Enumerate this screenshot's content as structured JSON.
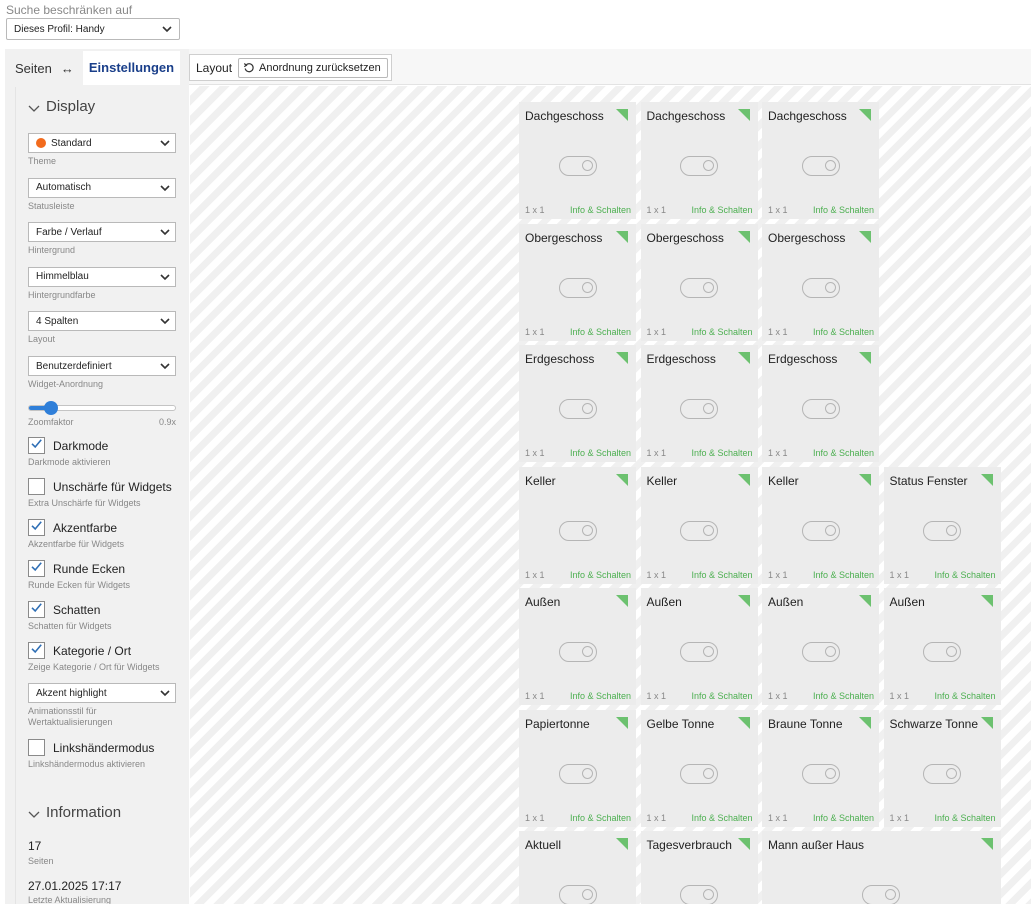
{
  "colors": {
    "accent": "#1a3f8a",
    "check": "#2f6fb5",
    "slider": "#2f7fd9",
    "tile_corner": "#6cc16f",
    "tile_type": "#4caf50",
    "theme_dot": "#f26b1d"
  },
  "scope": {
    "label": "Suche beschränken auf",
    "value": "Dieses Profil: Handy"
  },
  "sidebar": {
    "tab_pages": "Seiten",
    "swap_glyph": "↔",
    "tab_settings": "Einstellungen",
    "display": {
      "title": "Display",
      "fields": [
        {
          "value": "Standard",
          "caption": "Theme",
          "dot": true
        },
        {
          "value": "Automatisch",
          "caption": "Statusleiste"
        },
        {
          "value": "Farbe / Verlauf",
          "caption": "Hintergrund"
        },
        {
          "value": "Himmelblau",
          "caption": "Hintergrundfarbe"
        },
        {
          "value": "4 Spalten",
          "caption": "Layout"
        },
        {
          "value": "Benutzerdefiniert",
          "caption": "Widget-Anordnung"
        }
      ],
      "zoom": {
        "caption": "Zoomfaktor",
        "value_label": "0.9x",
        "fraction": 0.15
      },
      "checks": [
        {
          "label": "Darkmode",
          "caption": "Darkmode aktivieren",
          "checked": true
        },
        {
          "label": "Unschärfe für Widgets",
          "caption": "Extra Unschärfe für Widgets",
          "checked": false
        },
        {
          "label": "Akzentfarbe",
          "caption": "Akzentfarbe für Widgets",
          "checked": true
        },
        {
          "label": "Runde Ecken",
          "caption": "Runde Ecken für Widgets",
          "checked": true
        },
        {
          "label": "Schatten",
          "caption": "Schatten für Widgets",
          "checked": true
        },
        {
          "label": "Kategorie / Ort",
          "caption": "Zeige Kategorie / Ort für Widgets",
          "checked": true
        }
      ],
      "animation": {
        "value": "Akzent highlight",
        "caption_1": "Animationsstil für",
        "caption_2": "Wertaktualisierungen"
      },
      "lefthand": {
        "label": "Linkshändermodus",
        "caption": "Linkshändermodus aktivieren",
        "checked": false
      }
    },
    "information": {
      "title": "Information",
      "pages_value": "17",
      "pages_caption": "Seiten",
      "updated_value": "27.01.2025 17:17",
      "updated_caption": "Letzte Aktualisierung"
    }
  },
  "toolbar": {
    "layout_label": "Layout",
    "reset_label": "Anordnung zurücksetzen"
  },
  "tiles": [
    {
      "title": "Dachgeschoss",
      "size": "1 x 1",
      "type": "Info & Schalten"
    },
    {
      "title": "Dachgeschoss",
      "size": "1 x 1",
      "type": "Info & Schalten"
    },
    {
      "title": "Dachgeschoss",
      "size": "1 x 1",
      "type": "Info & Schalten"
    },
    {
      "title": "Obergeschoss",
      "size": "1 x 1",
      "type": "Info & Schalten"
    },
    {
      "title": "Obergeschoss",
      "size": "1 x 1",
      "type": "Info & Schalten"
    },
    {
      "title": "Obergeschoss",
      "size": "1 x 1",
      "type": "Info & Schalten"
    },
    {
      "title": "Erdgeschoss",
      "size": "1 x 1",
      "type": "Info & Schalten"
    },
    {
      "title": "Erdgeschoss",
      "size": "1 x 1",
      "type": "Info & Schalten"
    },
    {
      "title": "Erdgeschoss",
      "size": "1 x 1",
      "type": "Info & Schalten"
    },
    {
      "title": "Keller",
      "size": "1 x 1",
      "type": "Info & Schalten"
    },
    {
      "title": "Keller",
      "size": "1 x 1",
      "type": "Info & Schalten"
    },
    {
      "title": "Keller",
      "size": "1 x 1",
      "type": "Info & Schalten"
    },
    {
      "title": "Status Fenster",
      "size": "1 x 1",
      "type": "Info & Schalten"
    },
    {
      "title": "Außen",
      "size": "1 x 1",
      "type": "Info & Schalten"
    },
    {
      "title": "Außen",
      "size": "1 x 1",
      "type": "Info & Schalten"
    },
    {
      "title": "Außen",
      "size": "1 x 1",
      "type": "Info & Schalten"
    },
    {
      "title": "Außen",
      "size": "1 x 1",
      "type": "Info & Schalten"
    },
    {
      "title": "Papiertonne",
      "size": "1 x 1",
      "type": "Info & Schalten"
    },
    {
      "title": "Gelbe Tonne",
      "size": "1 x 1",
      "type": "Info & Schalten"
    },
    {
      "title": "Braune Tonne",
      "size": "1 x 1",
      "type": "Info & Schalten"
    },
    {
      "title": "Schwarze Tonne",
      "size": "1 x 1",
      "type": "Info & Schalten"
    },
    {
      "title": "Aktuell",
      "size": "",
      "type": ""
    },
    {
      "title": "Tagesverbrauch",
      "size": "",
      "type": ""
    },
    {
      "title": "Mann außer Haus",
      "size": "",
      "type": "",
      "span": 2
    }
  ]
}
